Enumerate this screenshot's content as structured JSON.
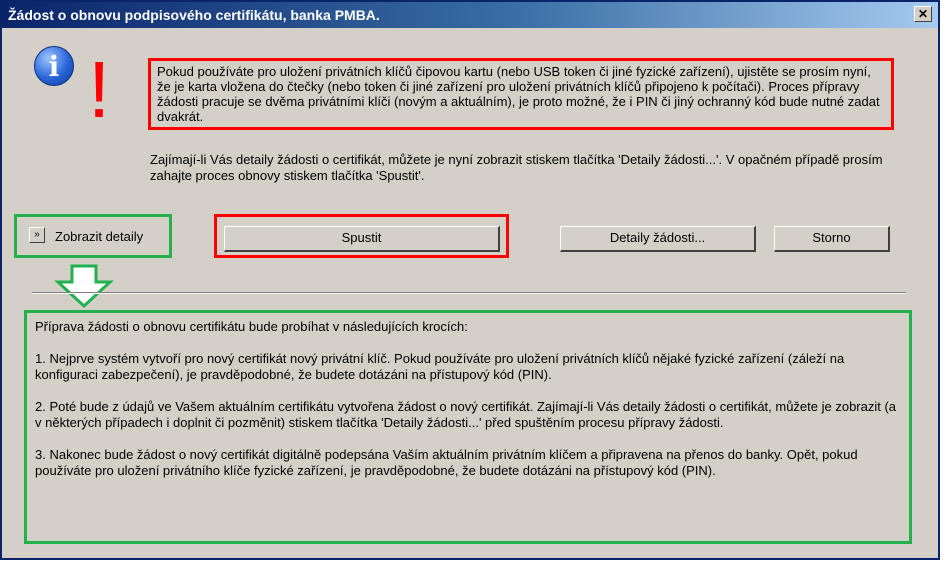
{
  "window": {
    "title": "Žádost o obnovu podpisového certifikátu, banka PMBA.",
    "close_glyph": "✕"
  },
  "icons": {
    "info_glyph": "i",
    "exclamation_glyph": "!",
    "toggle_glyph": "»"
  },
  "messages": {
    "warning": "Pokud používáte pro uložení privátních klíčů čipovou kartu (nebo USB token či jiné fyzické zařízení), ujistěte se prosím nyní, že je karta vložena do čtečky (nebo token či jiné zařízení pro uložení privátních klíčů připojeno k počítači). Proces přípravy žádosti pracuje se dvěma privátními klíči (novým a aktuálním), je proto možné, že i PIN či jiný ochranný kód bude nutné zadat dvakrát.",
    "info": "Zajímají-li Vás detaily žádosti o certifikát, můžete je nyní zobrazit stiskem tlačítka 'Detaily žádosti...'. V opačném případě prosím zahajte proces obnovy stiskem tlačítka 'Spustit'."
  },
  "controls": {
    "toggle_label": "Zobrazit detaily",
    "start_label": "Spustit",
    "details_label": "Detaily žádosti...",
    "cancel_label": "Storno"
  },
  "steps": {
    "intro": "Příprava žádosti o obnovu certifikátu bude probíhat v následujících krocích:",
    "items": [
      "1. Nejprve systém vytvoří pro nový certifikát nový privátní klíč. Pokud používáte pro uložení privátních klíčů nějaké fyzické zařízení (záleží na konfiguraci zabezpečení), je pravděpodobné, že budete dotázáni na přístupový kód (PIN).",
      "2. Poté bude z údajů ve Vašem aktuálním certifikátu vytvořena žádost o nový certifikát. Zajímají-li Vás detaily žádosti o certifikát, můžete je zobrazit (a v některých případech i doplnit či pozměnit) stiskem tlačítka 'Detaily žádosti...' před spuštěním procesu přípravy žádosti.",
      "3. Nakonec bude žádost o nový certifikát digitálně podepsána Vaším aktuálním privátním klíčem a připravena na přenos do banky. Opět, pokud používáte pro uložení privátního klíče fyzické zařízení, je pravděpodobné, že budete dotázáni na přístupový kód (PIN)."
    ]
  },
  "colors": {
    "highlight_red": "#ff0000",
    "highlight_green": "#22b14c",
    "title_bar": "#0a246a",
    "dialog_bg": "#d4d0c8"
  }
}
